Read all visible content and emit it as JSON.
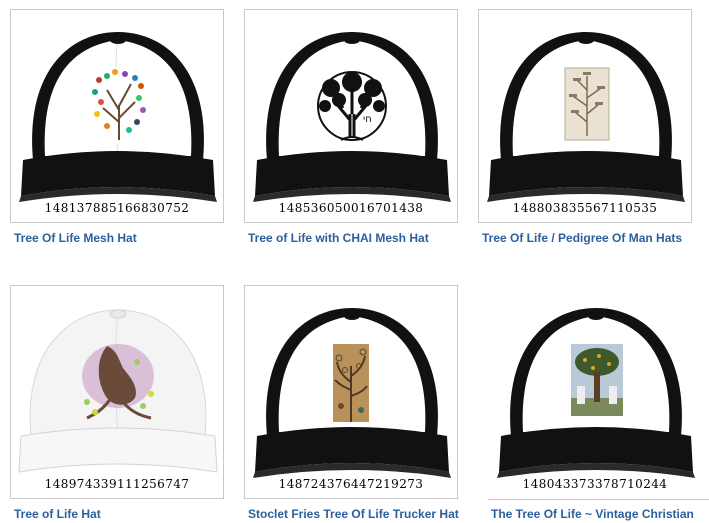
{
  "products": [
    {
      "id": "148137885166830752",
      "title": "Tree Of Life Mesh Hat",
      "hat": "black-trucker",
      "art": "colorful-tree-chart"
    },
    {
      "id": "148536050016701438",
      "title": "Tree of Life with CHAI Mesh Hat",
      "hat": "black-trucker",
      "art": "circular-tree-chai"
    },
    {
      "id": "148803835567110535",
      "title": "Tree Of Life / Pedigree Of Man Hats",
      "hat": "black-trucker",
      "art": "pedigree-chart"
    },
    {
      "id": "148974339111256747",
      "title": "Tree of Life Hat",
      "hat": "white-cap",
      "art": "woman-tree-figure"
    },
    {
      "id": "148724376447219273",
      "title": "Stoclet Fries Tree Of Life Trucker Hat",
      "hat": "black-trucker",
      "art": "klimt-tree"
    },
    {
      "id": "148043373378710244",
      "title": "The Tree Of Life ~ Vintage Christian",
      "hat": "black-trucker",
      "art": "vintage-christian-tree"
    }
  ],
  "colors": {
    "link": "#2c5f9e",
    "border": "#c9c9c9",
    "hat_black": "#111111"
  }
}
